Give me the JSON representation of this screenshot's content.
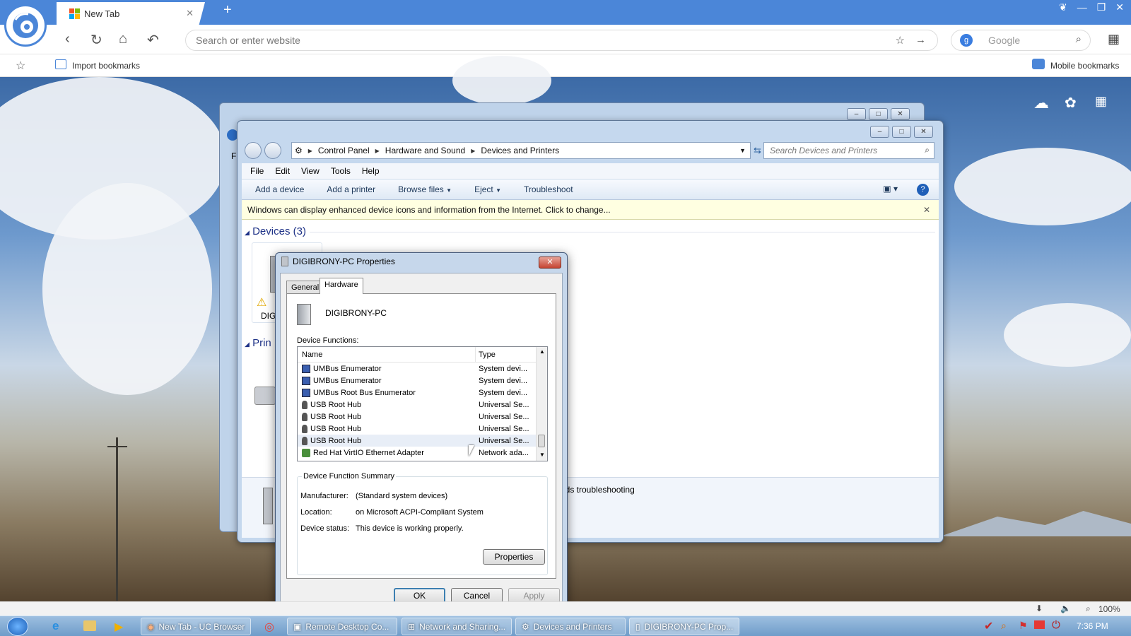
{
  "browser": {
    "tab_title": "New Tab",
    "address_placeholder": "Search or enter website",
    "search_engine": "Google",
    "import_bookmarks": "Import bookmarks",
    "mobile_bookmarks": "Mobile bookmarks",
    "zoom": "100%"
  },
  "explorer": {
    "breadcrumb": [
      "Control Panel",
      "Hardware and Sound",
      "Devices and Printers"
    ],
    "search_placeholder": "Search Devices and Printers",
    "menu": [
      "File",
      "Edit",
      "View",
      "Tools",
      "Help"
    ],
    "commands": [
      "Add a device",
      "Add a printer",
      "Browse files",
      "Eject",
      "Troubleshoot"
    ],
    "infobar": "Windows can display enhanced device icons and information from the Internet. Click to change...",
    "group_devices": "Devices (3)",
    "group_printers": "Prin",
    "device_label": "DIG",
    "troubleshoot_text": "eds troubleshooting",
    "back_menu_letter": "F"
  },
  "dialog": {
    "title": "DIGIBRONY-PC Properties",
    "tabs": [
      "General",
      "Hardware"
    ],
    "device_name": "DIGIBRONY-PC",
    "device_functions_label": "Device Functions:",
    "columns": [
      "Name",
      "Type"
    ],
    "rows": [
      {
        "name": "UMBus Enumerator",
        "type": "System devi..."
      },
      {
        "name": "UMBus Enumerator",
        "type": "System devi..."
      },
      {
        "name": "UMBus Root Bus Enumerator",
        "type": "System devi..."
      },
      {
        "name": "USB Root Hub",
        "type": "Universal Se..."
      },
      {
        "name": "USB Root Hub",
        "type": "Universal Se..."
      },
      {
        "name": "USB Root Hub",
        "type": "Universal Se..."
      },
      {
        "name": "USB Root Hub",
        "type": "Universal Se..."
      },
      {
        "name": "Red Hat VirtIO Ethernet Adapter",
        "type": "Network ada..."
      }
    ],
    "summary_title": "Device Function Summary",
    "manufacturer_label": "Manufacturer:",
    "manufacturer": "(Standard system devices)",
    "location_label": "Location:",
    "location": "on Microsoft ACPI-Compliant System",
    "status_label": "Device status:",
    "status": "This device is working properly.",
    "properties": "Properties",
    "ok": "OK",
    "cancel": "Cancel",
    "apply": "Apply"
  },
  "taskbar": {
    "items": [
      "New Tab - UC Browser",
      "Remote Desktop Co...",
      "Network and Sharing...",
      "Devices and Printers",
      "DIGIBRONY-PC Prop..."
    ],
    "clock": "7:36 PM"
  }
}
